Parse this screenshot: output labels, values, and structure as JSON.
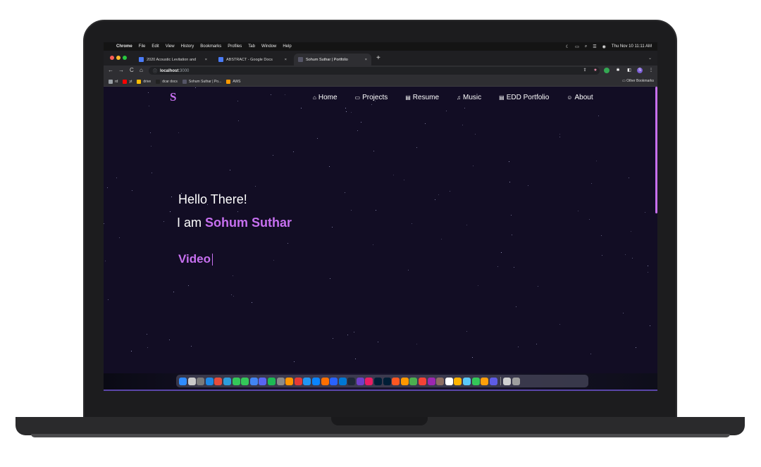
{
  "menubar": {
    "apple": "",
    "items": [
      "Chrome",
      "File",
      "Edit",
      "View",
      "History",
      "Bookmarks",
      "Profiles",
      "Tab",
      "Window",
      "Help"
    ],
    "clock": "Thu Nov 10  11:11 AM"
  },
  "tabs": [
    {
      "label": "2020 Acoustic Levitation and ",
      "icon_color": "#4a7bf7",
      "close": "×"
    },
    {
      "label": "ABSTRACT - Google Docs",
      "icon_color": "#4a7bf7",
      "close": "×"
    },
    {
      "label": "Sohum Suthar | Portfolio",
      "icon_color": "#555566",
      "close": "×"
    }
  ],
  "newtab_label": "+",
  "tabs_menu_label": "⌄",
  "address": {
    "host": "localhost",
    "port": ":3000",
    "secure_icon": "ⓘ"
  },
  "nav_controls": {
    "back": "←",
    "forward": "→",
    "reload": "C",
    "home": "⌂"
  },
  "extensions": [
    {
      "name": "share-icon",
      "glyph": "⇪",
      "color": "#2e2e32"
    },
    {
      "name": "star-icon",
      "glyph": "★",
      "color": "#2e2e32"
    },
    {
      "name": "extension-green-icon",
      "glyph": "",
      "color": "#34a853"
    },
    {
      "name": "puzzle-icon",
      "glyph": "✱",
      "color": "#2e2e32"
    },
    {
      "name": "sidepanel-icon",
      "glyph": "◧",
      "color": "#2e2e32"
    },
    {
      "name": "profile-avatar",
      "glyph": "S",
      "color": "#7b5cd6"
    },
    {
      "name": "menu-icon",
      "glyph": "⋮",
      "color": "#2e2e32"
    }
  ],
  "bookmarks": [
    {
      "label": "rd",
      "color": "#9aa0a6"
    },
    {
      "label": "yt",
      "color": "#ff0000"
    },
    {
      "label": "drive",
      "color": "#fbbc05"
    },
    {
      "label": "dcar docs",
      "color": "#222222"
    },
    {
      "label": "Sohum Suthar | Po...",
      "color": "#555566"
    },
    {
      "label": "AWS",
      "color": "#ff9900"
    }
  ],
  "other_bookmarks": "Other Bookmarks",
  "site": {
    "logo": "S",
    "nav": [
      {
        "label": "Home",
        "icon": "⌂"
      },
      {
        "label": "Projects",
        "icon": "▭"
      },
      {
        "label": "Resume",
        "icon": "▤"
      },
      {
        "label": "Music",
        "icon": "♫"
      },
      {
        "label": "EDD Portfolio",
        "icon": "▤"
      },
      {
        "label": "About",
        "icon": "☺"
      }
    ],
    "greeting": "Hello There!",
    "intro_prefix": "I am ",
    "name": "Sohum Suthar",
    "typed_text": "Video"
  },
  "colors": {
    "accent": "#c770f0",
    "page_bg": "#120d24"
  }
}
